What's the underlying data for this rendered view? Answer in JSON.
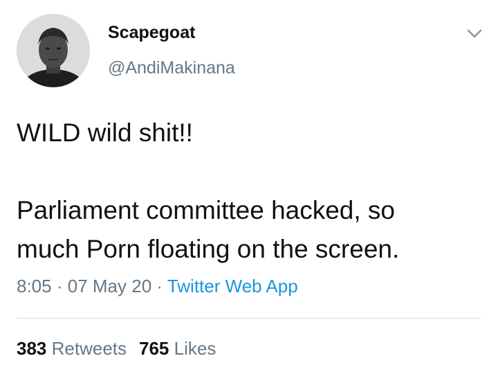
{
  "author": {
    "display_name": "Scapegoat",
    "handle": "@AndiMakinana"
  },
  "tweet": {
    "lines": [
      "WILD wild shit!!",
      "Parliament committee hacked, so",
      "much Porn floating on the screen."
    ]
  },
  "meta": {
    "time": "8:05",
    "sep1": "·",
    "date": "07 May 20",
    "sep2": "·",
    "source": "Twitter Web App"
  },
  "stats": {
    "retweets_count": "383",
    "retweets_label": "Retweets",
    "likes_count": "765",
    "likes_label": "Likes"
  },
  "icons": {
    "menu": "chevron-down-icon"
  },
  "colors": {
    "secondary_text": "#657786",
    "link": "#1b95e0",
    "divider": "#d8dde1"
  }
}
